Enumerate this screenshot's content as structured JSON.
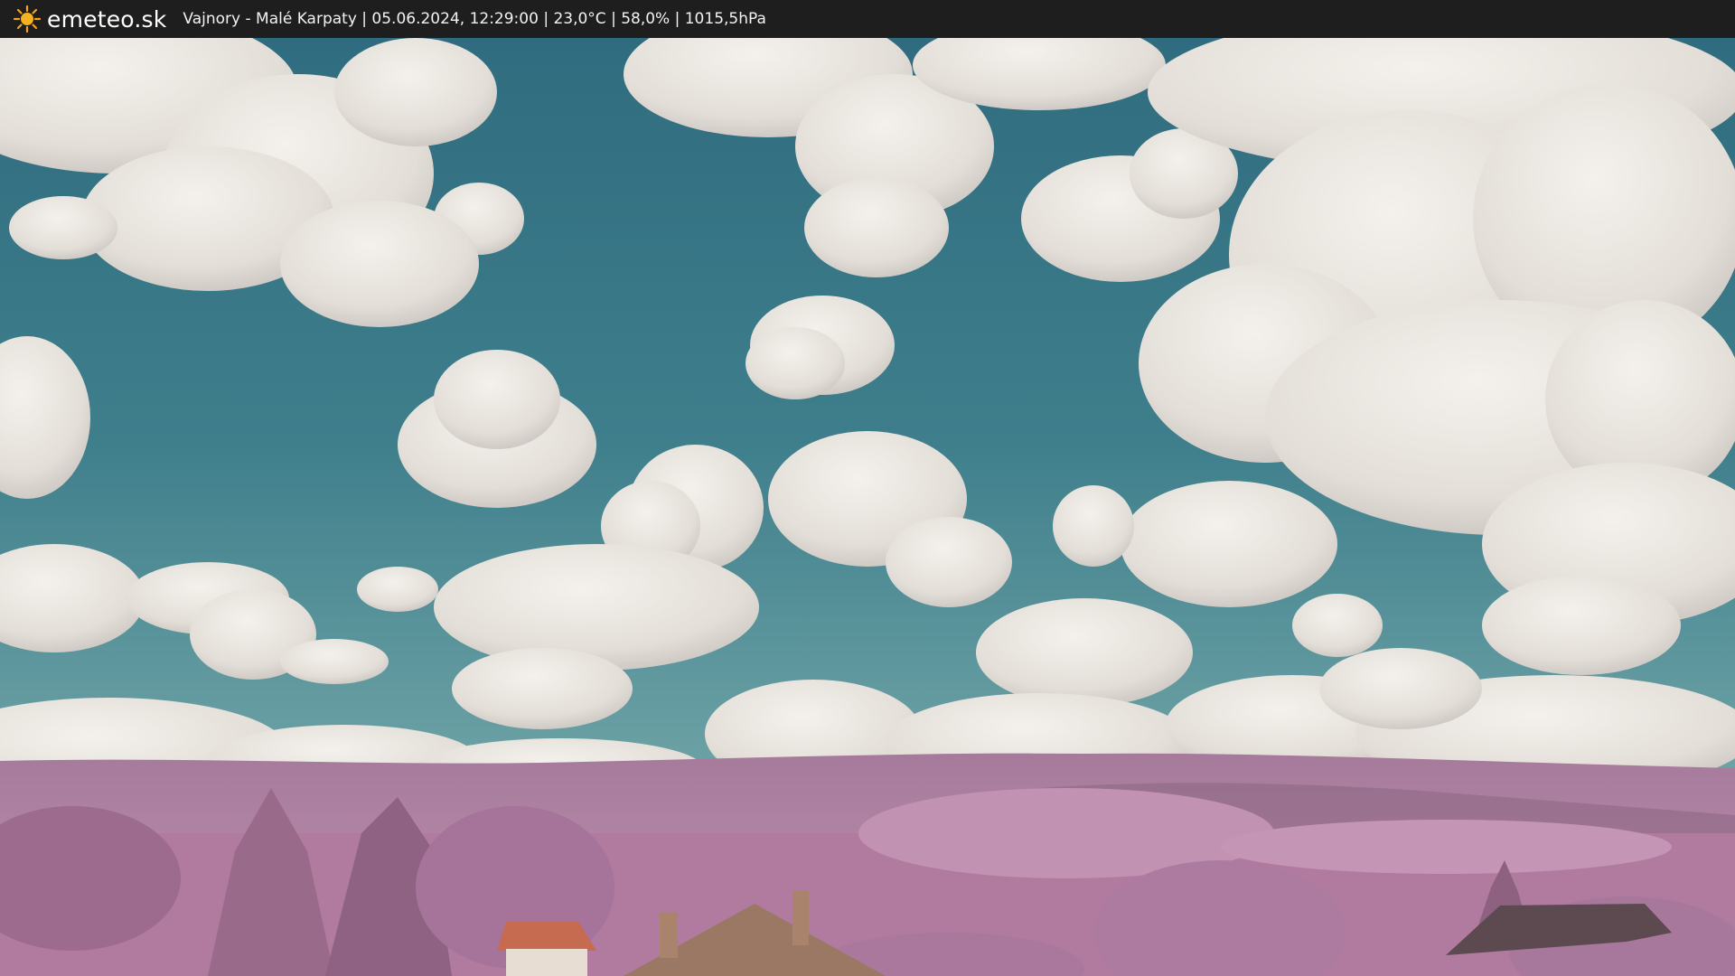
{
  "header": {
    "logo_icon": "sun-icon",
    "brand": "emeteo.sk",
    "info": "Vajnory - Malé Karpaty | 05.06.2024, 12:29:00 | 23,0°C | 58,0% | 1015,5hPa"
  },
  "colors": {
    "bar": "#1e1e1e",
    "sky_top": "#336f80",
    "sky_bottom": "#5d97a0",
    "cloud": "#ece8e2",
    "foliage": "#b27a9f",
    "field": "#d4c4a6",
    "roof": "#c8684f"
  }
}
